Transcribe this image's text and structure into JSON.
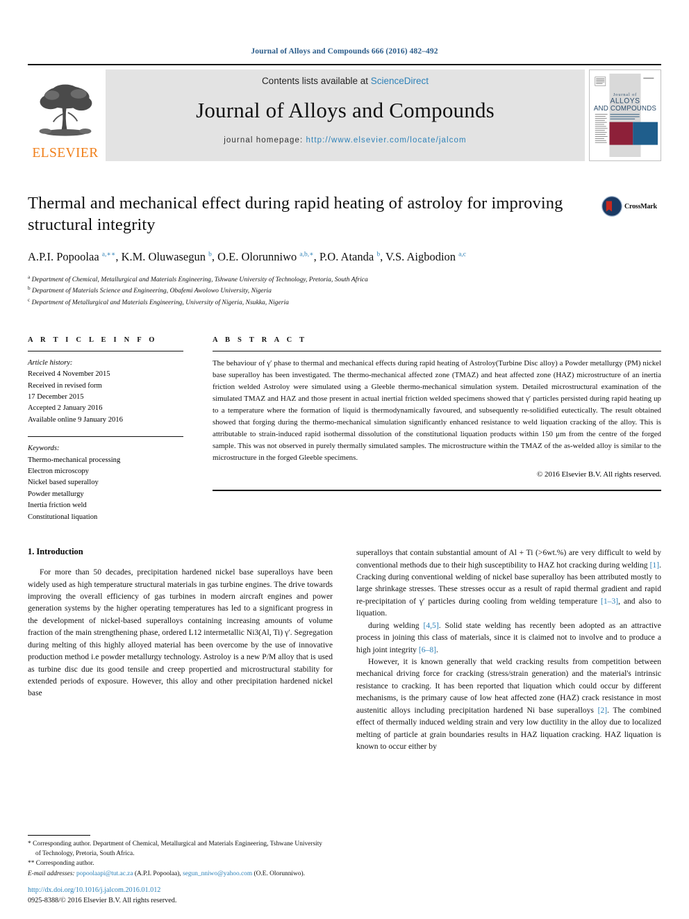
{
  "running_head": "Journal of Alloys and Compounds 666 (2016) 482–492",
  "banner": {
    "contents_prefix": "Contents lists available at ",
    "sciencedirect": "ScienceDirect",
    "journal_title": "Journal of Alloys and Compounds",
    "homepage_label": "journal homepage: ",
    "homepage_url": "http://www.elsevier.com/locate/jalcom",
    "publisher": "ELSEVIER",
    "publisher_color": "#F07F1A",
    "link_color": "#2f82b8",
    "cover": {
      "line1": "Journal of",
      "line2": "ALLOYS",
      "line3": "AND COMPOUNDS",
      "block_red": "#8d2039",
      "block_blue": "#1f5e8c"
    }
  },
  "article": {
    "title": "Thermal and mechanical effect during rapid heating of astroloy for improving structural integrity",
    "crossmark_label": "CrossMark",
    "authors_html": "A.P.I. Popoolaa <sup>a,∗∗</sup>, K.M. Oluwasegun <sup>b</sup>, O.E. Olorunniwo <sup>a,b,∗</sup>, P.O. Atanda <sup>b</sup>, V.S. Aigbodion <sup>a,c</sup>",
    "affiliations": [
      {
        "mark": "a",
        "text": "Department of Chemical, Metallurgical and Materials Engineering, Tshwane University of Technology, Pretoria, South Africa"
      },
      {
        "mark": "b",
        "text": "Department of Materials Science and Engineering, Obafemi Awolowo University, Nigeria"
      },
      {
        "mark": "c",
        "text": "Department of Metallurgical and Materials Engineering, University of Nigeria, Nsukka, Nigeria"
      }
    ]
  },
  "info": {
    "heading": "A R T I C L E  I N F O",
    "history_label": "Article history:",
    "history": [
      "Received 4 November 2015",
      "Received in revised form",
      "17 December 2015",
      "Accepted 2 January 2016",
      "Available online 9 January 2016"
    ],
    "keywords_label": "Keywords:",
    "keywords": [
      "Thermo-mechanical processing",
      "Electron microscopy",
      "Nickel based superalloy",
      "Powder metallurgy",
      "Inertia friction weld",
      "Constitutional liquation"
    ]
  },
  "abstract": {
    "heading": "A B S T R A C T",
    "text": "The behaviour of γ′ phase to thermal and mechanical effects during rapid heating of Astroloy(Turbine Disc alloy) a Powder metallurgy (PM) nickel base superalloy has been investigated. The thermo-mechanical affected zone (TMAZ) and heat affected zone (HAZ) microstructure of an inertia friction welded Astroloy were simulated using a Gleeble thermo-mechanical simulation system. Detailed microstructural examination of the simulated TMAZ and HAZ and those present in actual inertial friction welded specimens showed that γ′ particles persisted during rapid heating up to a temperature where the formation of liquid is thermodynamically favoured, and subsequently re-solidified eutectically. The result obtained showed that forging during the thermo-mechanical simulation significantly enhanced resistance to weld liquation cracking of the alloy. This is attributable to strain-induced rapid isothermal dissolution of the constitutional liquation products within 150 μm from the centre of the forged sample. This was not observed in purely thermally simulated samples. The microstructure within the TMAZ of the as-welded alloy is similar to the microstructure in the forged Gleeble specimens.",
    "copyright": "© 2016 Elsevier B.V. All rights reserved."
  },
  "body": {
    "section_title": "1. Introduction",
    "left_paragraph": "For more than 50 decades, precipitation hardened nickel base superalloys have been widely used as high temperature structural materials in gas turbine engines. The drive towards improving the overall efficiency of gas turbines in modern aircraft engines and power generation systems by the higher operating temperatures has led to a significant progress in the development of nickel-based superalloys containing increasing amounts of volume fraction of the main strengthening phase, ordered L12 intermetallic Ni3(Al, Ti) γ′. Segregation during melting of this highly alloyed material has been overcome by the use of innovative production method i.e powder metallurgy technology. Astroloy is a new P/M alloy that is used as turbine disc due its good tensile and creep propertied and microstructural stability for extended periods of exposure. However, this alloy and other precipitation hardened nickel base",
    "right_paragraph_1_html": "superalloys that contain substantial amount of Al + Ti (>6wt.%) are very difficult to weld by conventional methods due to their high susceptibility to HAZ hot cracking during welding <span class=\"cite\">[1]</span>. Cracking during conventional welding of nickel base superalloy has been attributed mostly to large shrinkage stresses. These stresses occur as a result of rapid thermal gradient and rapid re-precipitation of γ′ particles during cooling from welding temperature <span class=\"cite\">[1–3]</span>, and also to liquation.",
    "right_paragraph_2_html": "during welding <span class=\"cite\">[4,5]</span>. Solid state welding has recently been adopted as an attractive process in joining this class of materials, since it is claimed not to involve and to produce a high joint integrity <span class=\"cite\">[6–8]</span>.",
    "right_paragraph_3_html": "However, it is known generally that weld cracking results from competition between mechanical driving force for cracking (stress/strain generation) and the material's intrinsic resistance to cracking. It has been reported that liquation which could occur by different mechanisms, is the primary cause of low heat affected zone (HAZ) crack resistance in most austenitic alloys including precipitation hardened Ni base superalloys <span class=\"cite\">[2]</span>. The combined effect of thermally induced welding strain and very low ductility in the alloy due to localized melting of particle at grain boundaries results in HAZ liquation cracking. HAZ liquation is known to occur either by"
  },
  "footnotes": {
    "note_star_html": "<span class=\"star\">*</span> Corresponding author. Department of Chemical, Metallurgical and Materials Engineering, Tshwane University of Technology, Pretoria, South Africa.",
    "note_dstar_html": "<span class=\"star\">**</span> Corresponding author.",
    "emails_label": "E-mail addresses:",
    "email_1": "popoolaapi@tut.ac.za",
    "email_1_owner": "(A.P.I. Popoolaa)",
    "email_2": "segun_nniwo@yahoo.com",
    "email_2_owner": "(O.E. Olorunniwo).",
    "doi": "http://dx.doi.org/10.1016/j.jalcom.2016.01.012",
    "issn_line": "0925-8388/© 2016 Elsevier B.V. All rights reserved."
  }
}
